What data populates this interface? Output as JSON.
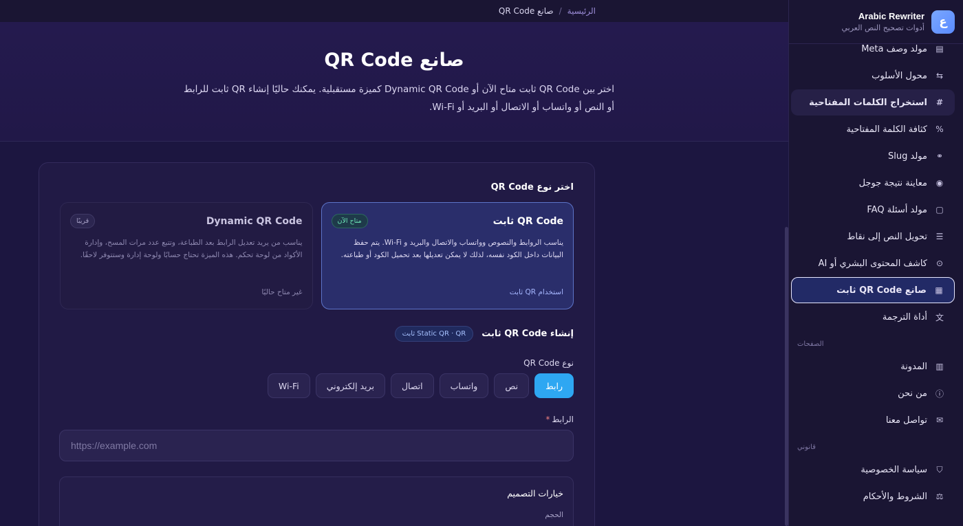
{
  "brand": {
    "name": "Arabic Rewriter",
    "subtitle": "أدوات تصحيح النص العربي",
    "logo_char": "ع"
  },
  "nav": {
    "items": [
      {
        "label": "مولد وصف Meta",
        "icon": "file-icon",
        "glyph": "▤"
      },
      {
        "label": "محول الأسلوب",
        "icon": "swap-icon",
        "glyph": "⇆"
      },
      {
        "label": "استخراج الكلمات المفتاحية",
        "icon": "hash-icon",
        "glyph": "#"
      },
      {
        "label": "كثافة الكلمة المفتاحية",
        "icon": "percent-icon",
        "glyph": "%"
      },
      {
        "label": "مولد Slug",
        "icon": "link-icon",
        "glyph": "⚭"
      },
      {
        "label": "معاينة نتيجة جوجل",
        "icon": "eye-icon",
        "glyph": "◉"
      },
      {
        "label": "مولد أسئلة FAQ",
        "icon": "chat-icon",
        "glyph": "▢"
      },
      {
        "label": "تحويل النص إلى نقاط",
        "icon": "list-icon",
        "glyph": "☰"
      },
      {
        "label": "كاشف المحتوى البشري أو AI",
        "icon": "scan-icon",
        "glyph": "⊙"
      },
      {
        "label": "صانع QR Code ثابت",
        "icon": "qr-icon",
        "glyph": "▦"
      },
      {
        "label": "أداة الترجمة",
        "icon": "translate-icon",
        "glyph": "文"
      }
    ],
    "pages_heading": "الصفحات",
    "pages": [
      {
        "label": "المدونة",
        "icon": "book-icon",
        "glyph": "▥"
      },
      {
        "label": "من نحن",
        "icon": "info-icon",
        "glyph": "ⓘ"
      },
      {
        "label": "تواصل معنا",
        "icon": "mail-icon",
        "glyph": "✉"
      }
    ],
    "legal_heading": "قانوني",
    "legal": [
      {
        "label": "سياسة الخصوصية",
        "icon": "shield-icon",
        "glyph": "⛉"
      },
      {
        "label": "الشروط والأحكام",
        "icon": "scale-icon",
        "glyph": "⚖"
      }
    ]
  },
  "breadcrumb": {
    "home": "الرئيسية",
    "sep": "/",
    "current": "صانع QR Code"
  },
  "hero": {
    "title": "صانع QR Code",
    "description": "اختر بين QR Code ثابت متاح الآن أو Dynamic QR Code كميزة مستقبلية. يمكنك حاليًا إنشاء QR ثابت للرابط أو النص أو واتساب أو الاتصال أو البريد أو Wi-Fi."
  },
  "card": {
    "choose_title": "اختر نوع QR Code",
    "static": {
      "title": "QR Code ثابت",
      "badge": "متاح الآن",
      "desc": "يناسب الروابط والنصوص وواتساب والاتصال والبريد و Wi-Fi. يتم حفظ البيانات داخل الكود نفسه، لذلك لا يمكن تعديلها بعد تحميل الكود أو طباعته.",
      "action": "استخدام QR ثابت"
    },
    "dynamic": {
      "title": "Dynamic QR Code",
      "badge": "قريبًا",
      "desc": "يناسب من يريد تعديل الرابط بعد الطباعة، وتتبع عدد مرات المسح، وإدارة الأكواد من لوحة تحكم. هذه الميزة تحتاج حسابًا ولوحة إدارة وستتوفر لاحقًا.",
      "status": "غير متاح حاليًا"
    },
    "create_title": "إنشاء QR Code ثابت",
    "create_pill": "Static QR · QR ثابت",
    "type_label": "نوع QR Code",
    "types": [
      "رابط",
      "نص",
      "واتساب",
      "اتصال",
      "بريد إلكتروني",
      "Wi-Fi"
    ],
    "selected_type": "رابط",
    "url_label": "الرابط",
    "required_mark": "*",
    "url_placeholder": "https://example.com",
    "design_title": "خيارات التصميم",
    "design_size": "الحجم"
  }
}
